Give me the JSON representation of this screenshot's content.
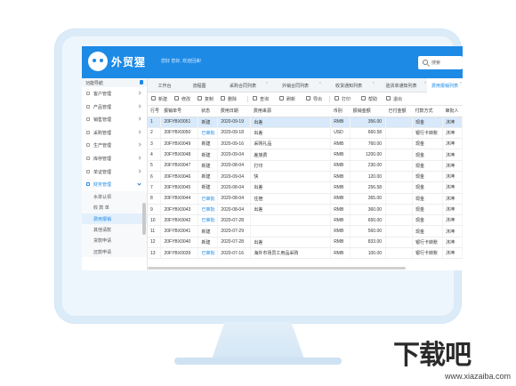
{
  "app": {
    "name": "外贸猩",
    "welcome": "您好 您好, 欢迎回来!"
  },
  "search": {
    "label": "搜索"
  },
  "sidebar": {
    "title": "功能导航",
    "items": [
      {
        "label": "客户管理"
      },
      {
        "label": "产品管理"
      },
      {
        "label": "销售管理"
      },
      {
        "label": "采购管理"
      },
      {
        "label": "生产管理"
      },
      {
        "label": "库存管理"
      },
      {
        "label": "单证管理"
      },
      {
        "label": "财务管理"
      }
    ],
    "subitems": [
      {
        "label": "水单认领"
      },
      {
        "label": "收 款 单"
      },
      {
        "label": "费用报销"
      },
      {
        "label": "其他请款"
      },
      {
        "label": "货款申请"
      },
      {
        "label": "还款申请"
      }
    ]
  },
  "tabs": [
    {
      "label": "工作台"
    },
    {
      "label": "流程图"
    },
    {
      "label": "采购合同列表"
    },
    {
      "label": "外销合同列表"
    },
    {
      "label": "收货通知列表"
    },
    {
      "label": "验货单通知列表"
    },
    {
      "label": "费用报销列表"
    }
  ],
  "toolbar": [
    {
      "label": "新建"
    },
    {
      "label": "修改"
    },
    {
      "label": "复制"
    },
    {
      "label": "删除"
    },
    {
      "label": "查询"
    },
    {
      "label": "刷新"
    },
    {
      "label": "导出"
    },
    {
      "label": "打印"
    },
    {
      "label": "帮助"
    },
    {
      "label": "退出"
    }
  ],
  "table": {
    "headers": [
      "行号",
      "报销单号",
      "状态",
      "费用日期",
      "费用来源",
      "币别",
      "报销金额",
      "已付金额",
      "付款方式",
      "审批人"
    ],
    "rows": [
      [
        "1",
        "20FYBX0051",
        "新建",
        "2020-09-19",
        "出差",
        "RMB",
        "356.00",
        "",
        "现金",
        "沐坤"
      ],
      [
        "2",
        "20FYBX0050",
        "已审批",
        "2020-09-18",
        "出差",
        "USD",
        "660.58",
        "",
        "银行卡转账",
        "沐坤"
      ],
      [
        "3",
        "20FYBX0049",
        "新建",
        "2020-09-16",
        "采购礼品",
        "RMB",
        "760.00",
        "",
        "现金",
        "沐坤"
      ],
      [
        "4",
        "20FYBX0048",
        "新建",
        "2020-09-04",
        "差旅费",
        "RMB",
        "1200.00",
        "",
        "现金",
        "沐坤"
      ],
      [
        "5",
        "20FYBX0047",
        "新建",
        "2020-08-04",
        "打印",
        "RMB",
        "230.00",
        "",
        "现金",
        "沐坤"
      ],
      [
        "6",
        "20FYBX0046",
        "新建",
        "2020-09-04",
        "快",
        "RMB",
        "120.00",
        "",
        "现金",
        "沐坤"
      ],
      [
        "7",
        "20FYBX0045",
        "新建",
        "2020-08-04",
        "出差",
        "RMB",
        "256.58",
        "",
        "现金",
        "沐坤"
      ],
      [
        "8",
        "20FYBX0044",
        "已审批",
        "2020-08-04",
        "住宿",
        "RMB",
        "365.00",
        "",
        "现金",
        "沐坤"
      ],
      [
        "9",
        "20FYBX0043",
        "已审批",
        "2020-08-04",
        "出差",
        "RMB",
        "360.00",
        "",
        "现金",
        "沐坤"
      ],
      [
        "10",
        "20FYBX0042",
        "已审批",
        "2020-07-28",
        "",
        "RMB",
        "650.00",
        "",
        "现金",
        "沐坤"
      ],
      [
        "11",
        "20FYBX0041",
        "新建",
        "2020-07-29",
        "",
        "RMB",
        "560.00",
        "",
        "现金",
        "沐坤"
      ],
      [
        "12",
        "20FYBX0040",
        "新建",
        "2020-07-28",
        "出差",
        "RMB",
        "833.00",
        "",
        "银行卡转账",
        "沐坤"
      ],
      [
        "13",
        "20FYBX0039",
        "已审批",
        "2020-07-16",
        "海外市场员工用品采购",
        "RMB",
        "100.00",
        "",
        "银行卡转账",
        "沐坤"
      ]
    ]
  },
  "watermark": {
    "logo": "下载吧",
    "url": "www.xiazaiba.com"
  },
  "colors": {
    "header": "#1d8ae6",
    "selected_row": "#d7e9fb",
    "approved": "#1d8ae6"
  }
}
